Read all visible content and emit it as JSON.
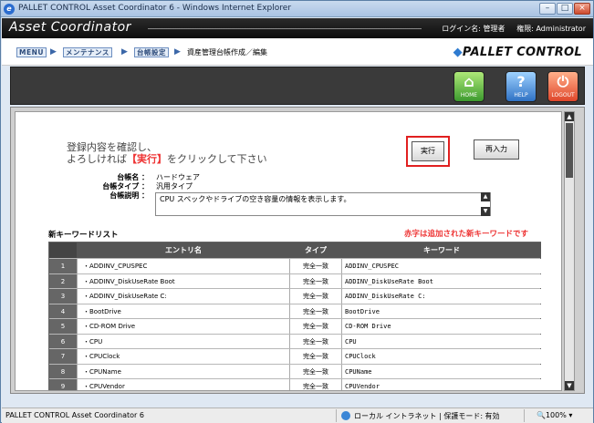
{
  "window": {
    "title": "PALLET CONTROL Asset Coordinator 6 - Windows Internet Explorer",
    "min": "–",
    "max": "□",
    "close": "×"
  },
  "app": {
    "logo": "Asset Coordinator",
    "login_label": "ログイン名: 管理者",
    "auth_label": "権限: Administrator"
  },
  "nav": {
    "crumbs": [
      "MENU",
      "メンテナンス",
      "台帳設定"
    ],
    "current": "資産管理台帳作成／編集",
    "brand": "PALLET CONTROL"
  },
  "toolbar": {
    "home": "HOME",
    "help": "HELP",
    "logout": "LOGOUT"
  },
  "form": {
    "message_line1": "登録内容を確認し、",
    "message_line2_pre": "よろしければ",
    "message_line2_em": "【実行】",
    "message_line2_post": "をクリックして下さい",
    "execute_button": "実行",
    "reenter_button": "再入力",
    "ledger_name_label": "台帳名 ：",
    "ledger_name_value": "ハードウェア",
    "ledger_type_label": "台帳タイプ ：",
    "ledger_type_value": "汎用タイプ",
    "ledger_desc_label": "台帳説明 ：",
    "ledger_desc_value": "CPU スペックやドライブの空き容量の情報を表示します。"
  },
  "keyword_list": {
    "title": "新キーワードリスト",
    "note": "赤字は追加された新キーワードです",
    "headers": {
      "no": "",
      "entry": "エントリ名",
      "type": "タイプ",
      "keyword": "キーワード"
    },
    "rows": [
      {
        "no": "1",
        "entry": "・ADDINV_CPUSPEC",
        "type": "完全一致",
        "keyword": "ADDINV_CPUSPEC"
      },
      {
        "no": "2",
        "entry": "・ADDINV_DiskUseRate Boot",
        "type": "完全一致",
        "keyword": "ADDINV_DiskUseRate Boot"
      },
      {
        "no": "3",
        "entry": "・ADDINV_DiskUseRate C:",
        "type": "完全一致",
        "keyword": "ADDINV_DiskUseRate C:"
      },
      {
        "no": "4",
        "entry": "・BootDrive",
        "type": "完全一致",
        "keyword": "BootDrive"
      },
      {
        "no": "5",
        "entry": "・CD-ROM Drive",
        "type": "完全一致",
        "keyword": "CD-ROM Drive"
      },
      {
        "no": "6",
        "entry": "・CPU",
        "type": "完全一致",
        "keyword": "CPU"
      },
      {
        "no": "7",
        "entry": "・CPUClock",
        "type": "完全一致",
        "keyword": "CPUClock"
      },
      {
        "no": "8",
        "entry": "・CPUName",
        "type": "完全一致",
        "keyword": "CPUName"
      },
      {
        "no": "9",
        "entry": "・CPUVendor",
        "type": "完全一致",
        "keyword": "CPUVendor"
      }
    ]
  },
  "statusbar": {
    "left": "PALLET CONTROL Asset Coordinator 6",
    "zone": "ローカル イントラネット | 保護モード: 有効",
    "zoom": "100%"
  },
  "colors": {
    "accent_red": "#e33333",
    "toolbar_bg": "#3a3a3a",
    "appbar_bg": "#111111"
  }
}
